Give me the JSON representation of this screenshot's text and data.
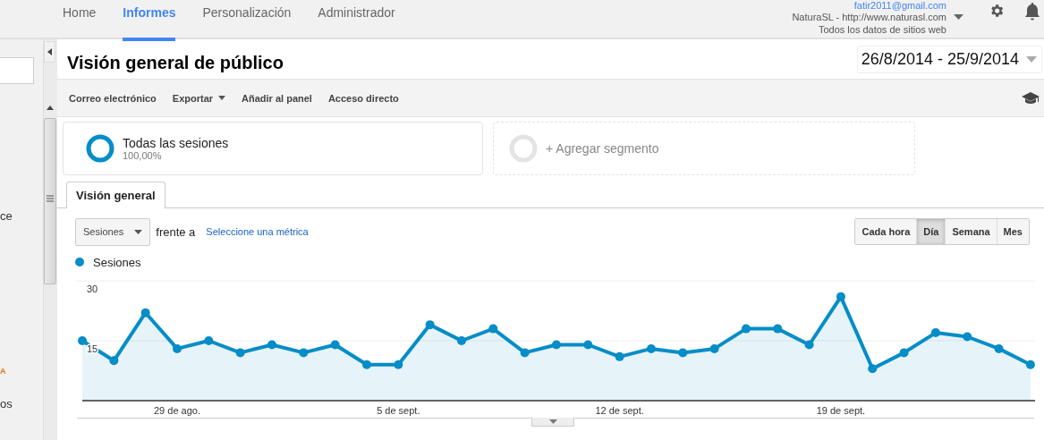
{
  "top_nav": {
    "tabs": [
      {
        "label": "Home",
        "selected": false
      },
      {
        "label": "Informes",
        "selected": true
      },
      {
        "label": "Personalización",
        "selected": false
      },
      {
        "label": "Administrador",
        "selected": false
      }
    ],
    "account": {
      "email": "fatir2011@gmail.com",
      "property": "NaturaSL - http://www.naturasl.com",
      "view": "Todos los datos de sitios web"
    }
  },
  "sidebar": {
    "fragments": [
      {
        "text": "ce",
        "color": "#333333"
      },
      {
        "text": "A",
        "color": "#e8710a"
      },
      {
        "text": "os",
        "color": "#333333"
      }
    ]
  },
  "header": {
    "title": "Visión general de público",
    "date_range": "26/8/2014 - 25/9/2014"
  },
  "toolbar": [
    {
      "label": "Correo electrónico",
      "dropdown": false
    },
    {
      "label": "Exportar",
      "dropdown": true
    },
    {
      "label": "Añadir al panel",
      "dropdown": false
    },
    {
      "label": "Acceso directo",
      "dropdown": false
    }
  ],
  "segments": [
    {
      "kind": "segment",
      "name": "Todas las sesiones",
      "share": "100,00%"
    },
    {
      "kind": "add",
      "name": "+ Agregar segmento"
    }
  ],
  "report_tabs": [
    {
      "label": "Visión general",
      "selected": true
    }
  ],
  "metric": {
    "primary": "Sesiones",
    "versus": "frente a",
    "secondary_link": "Seleccione una métrica"
  },
  "granularity": [
    {
      "label": "Cada hora",
      "selected": false
    },
    {
      "label": "Día",
      "selected": true
    },
    {
      "label": "Semana",
      "selected": false
    },
    {
      "label": "Mes",
      "selected": false
    }
  ],
  "chart": {
    "chart_data": {
      "type": "area",
      "ylim": [
        0,
        30
      ],
      "yticks": [
        15,
        30
      ],
      "categories": [
        null,
        null,
        null,
        "29 de ago.",
        null,
        null,
        null,
        null,
        null,
        null,
        "5 de sept.",
        null,
        null,
        null,
        null,
        null,
        null,
        "12 de sept.",
        null,
        null,
        null,
        null,
        null,
        null,
        "19 de sept.",
        null,
        null,
        null,
        null,
        null,
        null
      ],
      "series": [
        {
          "name": "Sesiones",
          "color": "#058dc7",
          "values": [
            15,
            10,
            22,
            13,
            15,
            12,
            14,
            12,
            14,
            9,
            9,
            19,
            15,
            18,
            12,
            14,
            14,
            11,
            13,
            12,
            13,
            18,
            18,
            14,
            26,
            8,
            12,
            17,
            16,
            13,
            9
          ]
        }
      ]
    }
  }
}
